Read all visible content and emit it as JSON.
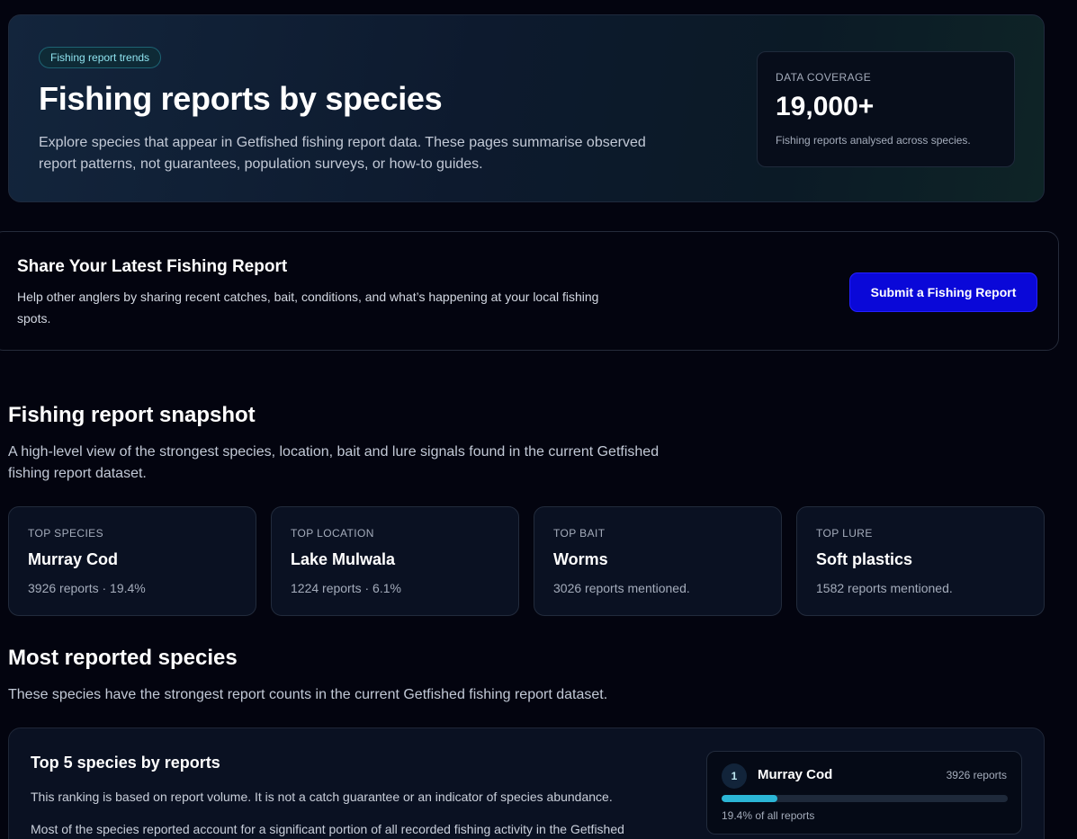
{
  "hero": {
    "badge": "Fishing report trends",
    "title": "Fishing reports by species",
    "description": "Explore species that appear in Getfished fishing report data. These pages summarise observed report patterns, not guarantees, population surveys, or how-to guides.",
    "coverage": {
      "label": "DATA COVERAGE",
      "value": "19,000+",
      "note": "Fishing reports analysed across species."
    }
  },
  "share": {
    "title": "Share Your Latest Fishing Report",
    "description": "Help other anglers by sharing recent catches, bait, conditions, and what’s happening at your local fishing spots.",
    "button": "Submit a Fishing Report"
  },
  "snapshot": {
    "title": "Fishing report snapshot",
    "description": "A high-level view of the strongest species, location, bait and lure signals found in the current Getfished fishing report dataset.",
    "cards": [
      {
        "label": "TOP SPECIES",
        "value": "Murray Cod",
        "sub": "3926 reports · 19.4%"
      },
      {
        "label": "TOP LOCATION",
        "value": "Lake Mulwala",
        "sub": "1224 reports · 6.1%"
      },
      {
        "label": "TOP BAIT",
        "value": "Worms",
        "sub": "3026 reports mentioned."
      },
      {
        "label": "TOP LURE",
        "value": "Soft plastics",
        "sub": "1582 reports mentioned."
      }
    ]
  },
  "most_reported": {
    "title": "Most reported species",
    "description": "These species have the strongest report counts in the current Getfished fishing report dataset.",
    "panel": {
      "title": "Top 5 species by reports",
      "description": "This ranking is based on report volume. It is not a catch guarantee or an indicator of species abundance.",
      "description2": "Most of the species reported account for a significant portion of all recorded fishing activity in the Getfished",
      "ranking": [
        {
          "rank": "1",
          "name": "Murray Cod",
          "count": "3926 reports",
          "share_text": "19.4% of all reports",
          "share": 0.194
        }
      ]
    }
  },
  "colors": {
    "accent": "#2bb6d6",
    "button": "#0a08d8",
    "background": "#03040f"
  }
}
